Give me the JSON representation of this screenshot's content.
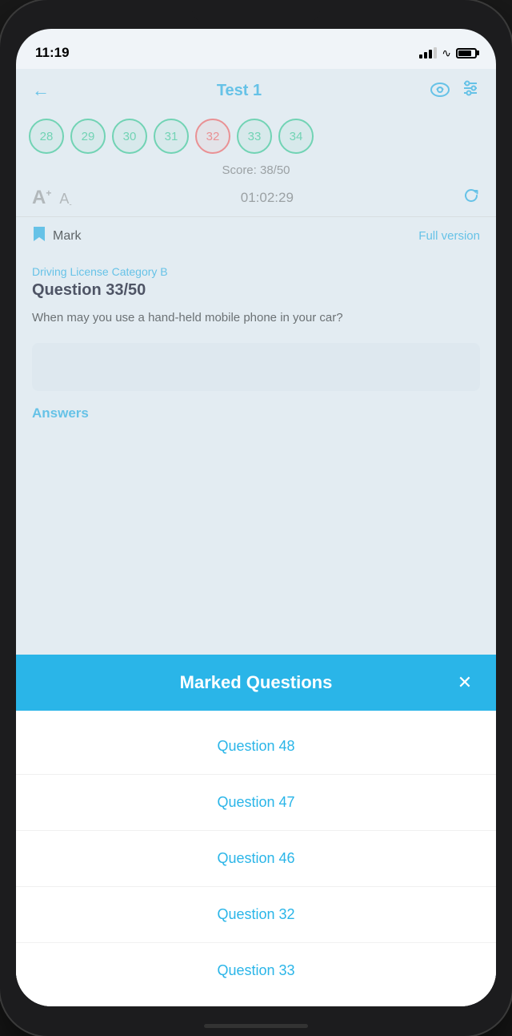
{
  "status_bar": {
    "time": "11:19",
    "battery_indicator": "lock"
  },
  "header": {
    "back_label": "‹",
    "title": "Test 1",
    "cloud_icon": "☁",
    "settings_icon": "⊟"
  },
  "question_numbers": [
    {
      "num": "28",
      "state": "green"
    },
    {
      "num": "29",
      "state": "green"
    },
    {
      "num": "30",
      "state": "green"
    },
    {
      "num": "31",
      "state": "green"
    },
    {
      "num": "32",
      "state": "red"
    },
    {
      "num": "33",
      "state": "green"
    },
    {
      "num": "34",
      "state": "green"
    }
  ],
  "score": {
    "label": "Score: 38/50"
  },
  "timer": {
    "font_up": "A",
    "font_down": "A",
    "time": "01:02:29"
  },
  "mark_row": {
    "mark_label": "Mark",
    "full_version_label": "Full version"
  },
  "question": {
    "category": "Driving License Category B",
    "title": "Question 33/50",
    "text": "When may you use a hand-held mobile phone in your car?"
  },
  "answers_header": "Answers",
  "modal": {
    "title": "Marked Questions",
    "close_label": "✕",
    "items": [
      {
        "label": "Question 48"
      },
      {
        "label": "Question 47"
      },
      {
        "label": "Question 46"
      },
      {
        "label": "Question 32"
      },
      {
        "label": "Question 33"
      }
    ]
  }
}
